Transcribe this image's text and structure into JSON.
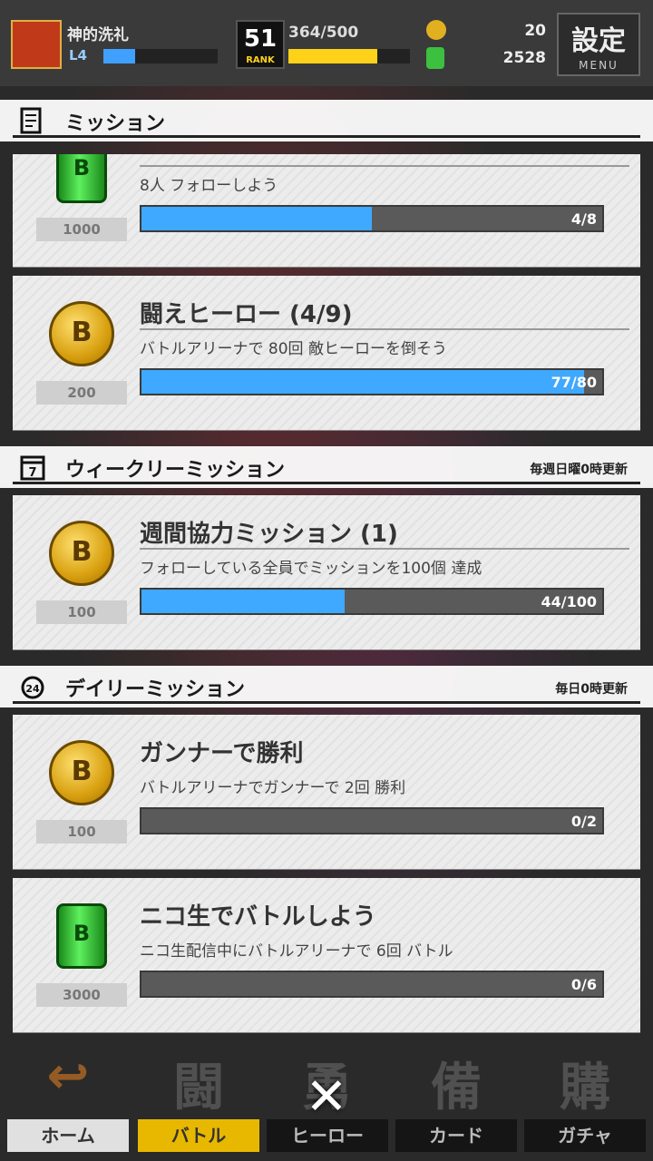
{
  "player": {
    "name": "神的洗礼",
    "level": "L4"
  },
  "rank": {
    "number": "51",
    "label": "RANK",
    "stamina": "364/500"
  },
  "currency": {
    "coins": "20",
    "cans": "2528"
  },
  "menu": {
    "kanji": "設定",
    "label": "MENU"
  },
  "sections": {
    "missions": {
      "title": "ミッション"
    },
    "weekly": {
      "title": "ウィークリーミッション",
      "note": "毎週日曜0時更新",
      "icon_text": "7"
    },
    "daily": {
      "title": "デイリーミッション",
      "note": "毎日0時更新",
      "icon_text": "24"
    }
  },
  "cards": [
    {
      "icon": "can-icon",
      "icon_text": "B",
      "reward": "1000",
      "title": "",
      "desc": "8人 フォローしよう",
      "progress_text": "4/8",
      "progress": 0.5
    },
    {
      "icon": "coin-icon",
      "icon_text": "B",
      "reward": "200",
      "title": "闘えヒーロー (4/9)",
      "desc": "バトルアリーナで 80回 敵ヒーローを倒そう",
      "progress_text": "77/80",
      "progress": 0.9625
    },
    {
      "icon": "coin-icon",
      "icon_text": "B",
      "reward": "100",
      "title": "週間協力ミッション (1)",
      "desc": "フォローしている全員でミッションを100個 達成",
      "progress_text": "44/100",
      "progress": 0.44
    },
    {
      "icon": "coin-icon",
      "icon_text": "B",
      "reward": "100",
      "title": "ガンナーで勝利",
      "desc": "バトルアリーナでガンナーで 2回 勝利",
      "progress_text": "0/2",
      "progress": 0
    },
    {
      "icon": "can-icon",
      "icon_text": "B",
      "reward": "3000",
      "title": "ニコ生でバトルしよう",
      "desc": "ニコ生配信中にバトルアリーナで 6回 バトル",
      "progress_text": "0/6",
      "progress": 0
    }
  ],
  "nav": [
    {
      "kanji": "↩",
      "label": "ホーム"
    },
    {
      "kanji": "闘",
      "label": "バトル"
    },
    {
      "kanji": "勇",
      "label": "ヒーロー"
    },
    {
      "kanji": "備",
      "label": "カード"
    },
    {
      "kanji": "購",
      "label": "ガチャ"
    }
  ],
  "close": {
    "symbol": "✕"
  }
}
